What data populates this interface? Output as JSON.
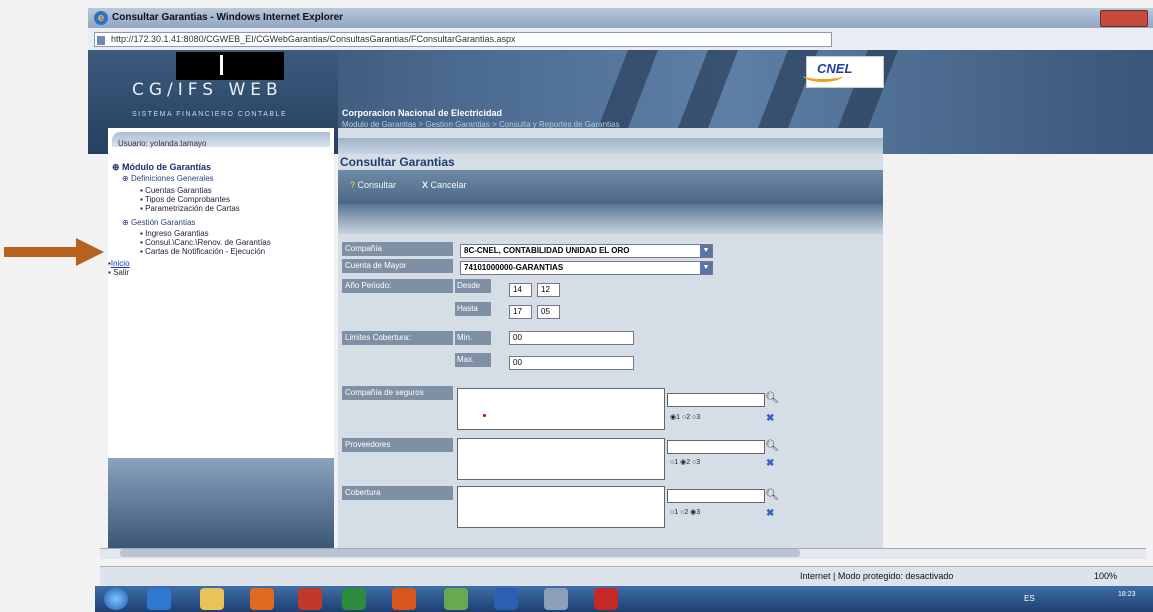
{
  "window": {
    "title": "Consultar Garantias - Windows Internet Explorer",
    "url": "http://172.30.1.41:8080/CGWEB_EI/CGWebGarantias/ConsultasGarantias/FConsultarGarantias.aspx"
  },
  "banner": {
    "app_name": "CG/IFS WEB",
    "app_subtitle": "SISTEMA FINANCIERO CONTABLE",
    "company": "Corporacion Nacional de Electricidad",
    "breadcrumb": "Modulo de Garantias > Gestion Garantias > Consulta y Reportes de Garantias",
    "logo_text": "CNEL"
  },
  "sidebar": {
    "user": "Usuario: yolanda.tamayo",
    "module_title": "Módulo de Garantías",
    "group1": "Definiciones Generales",
    "group1_items": [
      "Cuentas Garantias",
      "Tipos de Comprobantes",
      "Parametrización de Cartas"
    ],
    "group2": "Gestión Garantias",
    "group2_items": [
      "Ingreso Garantias",
      "Consul.\\Canc.\\Renov. de Garantías",
      "Cartas de Notificación - Ejecución"
    ],
    "inicio": "Inicio",
    "salir": "Salir"
  },
  "page": {
    "title": "Consultar Garantias",
    "btn_consultar": "Consultar",
    "btn_cancelar": "Cancelar"
  },
  "form": {
    "compania_label": "Compañía",
    "compania_value": "8C-CNEL, CONTABILIDAD UNIDAD EL ORO",
    "cuenta_label": "Cuenta de Mayor",
    "cuenta_value": "74101000000-GARANTIAS",
    "anio_label": "Año Periodo:",
    "desde_label": "Desde",
    "desde_a": "14",
    "desde_b": "12",
    "hasta_label": "Hasta",
    "hasta_a": "17",
    "hasta_b": "05",
    "limites_label": "Limites Cobertura:",
    "min_label": "Min.",
    "min_value": "00",
    "max_label": "Max.",
    "max_value": "00",
    "seguros_label": "Compañía de seguros",
    "proveedores_label": "Proveedores",
    "cobertura_label": "Cobertura",
    "radio_labels": [
      "1",
      "2",
      "3"
    ],
    "radio_selected": [
      1,
      2,
      3
    ]
  },
  "status": {
    "text": "Internet | Modo protegido: desactivado",
    "zoom": "100%"
  },
  "taskbar": {
    "lang": "ES",
    "time": "18:23"
  },
  "colors": {
    "banner": "#4b6a8f",
    "arrow": "#b5621f",
    "title_blue": "#1e3f6e"
  }
}
